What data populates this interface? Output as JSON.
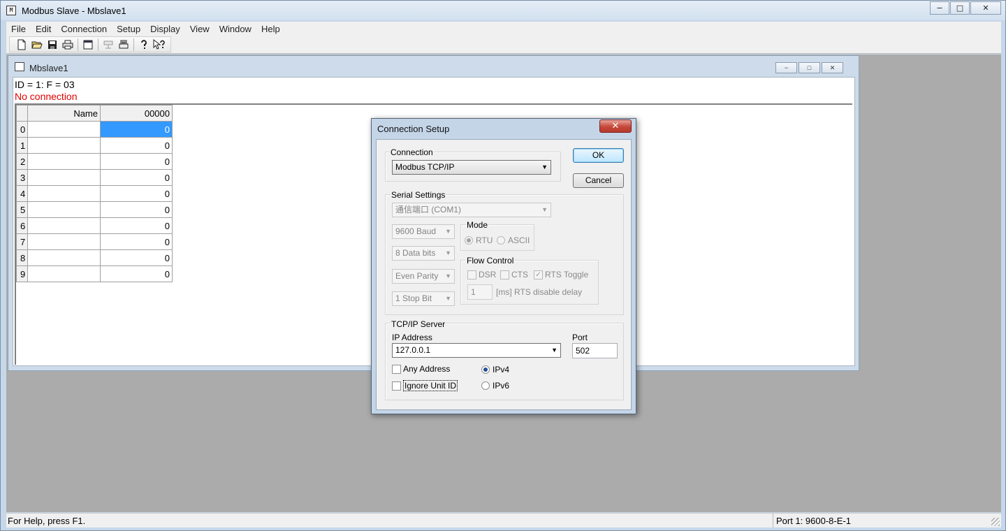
{
  "window": {
    "title": "Modbus Slave - Mbslave1",
    "minimize": "−",
    "maximize": "□",
    "close": "✕"
  },
  "menu": [
    "File",
    "Edit",
    "Connection",
    "Setup",
    "Display",
    "View",
    "Window",
    "Help"
  ],
  "toolbar": {
    "icons": [
      "new-icon",
      "open-icon",
      "save-icon",
      "print-icon",
      "window-icon",
      "connect-icon",
      "print-preview-icon",
      "help-icon",
      "context-help-icon"
    ]
  },
  "child": {
    "title": "Mbslave1",
    "id_line": "ID = 1: F = 03",
    "status_line": "No connection",
    "colors": {
      "status": "#e00000",
      "selected": "#3399ff"
    },
    "grid": {
      "headers": [
        "Name",
        "00000"
      ],
      "rows": [
        {
          "idx": "0",
          "name": "",
          "value": "0"
        },
        {
          "idx": "1",
          "name": "",
          "value": "0"
        },
        {
          "idx": "2",
          "name": "",
          "value": "0"
        },
        {
          "idx": "3",
          "name": "",
          "value": "0"
        },
        {
          "idx": "4",
          "name": "",
          "value": "0"
        },
        {
          "idx": "5",
          "name": "",
          "value": "0"
        },
        {
          "idx": "6",
          "name": "",
          "value": "0"
        },
        {
          "idx": "7",
          "name": "",
          "value": "0"
        },
        {
          "idx": "8",
          "name": "",
          "value": "0"
        },
        {
          "idx": "9",
          "name": "",
          "value": "0"
        }
      ]
    }
  },
  "statusbar": {
    "help": "For Help, press F1.",
    "port": "Port 1: 9600-8-E-1"
  },
  "dialog": {
    "title": "Connection Setup",
    "close": "✕",
    "connection_label": "Connection",
    "connection_value": "Modbus TCP/IP",
    "ok": "OK",
    "cancel": "Cancel",
    "serial_label": "Serial Settings",
    "port_value": "通信端口 (COM1)",
    "baud_value": "9600 Baud",
    "data_bits_value": "8 Data bits",
    "parity_value": "Even Parity",
    "stop_bits_value": "1 Stop Bit",
    "mode_label": "Mode",
    "mode_rtu": "RTU",
    "mode_ascii": "ASCII",
    "flow_label": "Flow Control",
    "dsr": "DSR",
    "cts": "CTS",
    "rts_toggle": "RTS Toggle",
    "rts_delay_value": "1",
    "rts_delay_label": "[ms] RTS disable delay",
    "tcp_label": "TCP/IP Server",
    "ip_label": "IP Address",
    "ip_value": "127.0.0.1",
    "port_label": "Port",
    "port_number": "502",
    "any_address": "Any Address",
    "ignore_unit_id": "Ignore Unit ID",
    "ipv4": "IPv4",
    "ipv6": "IPv6",
    "checkmark": "✓",
    "dropdown_arrow": "▼"
  }
}
